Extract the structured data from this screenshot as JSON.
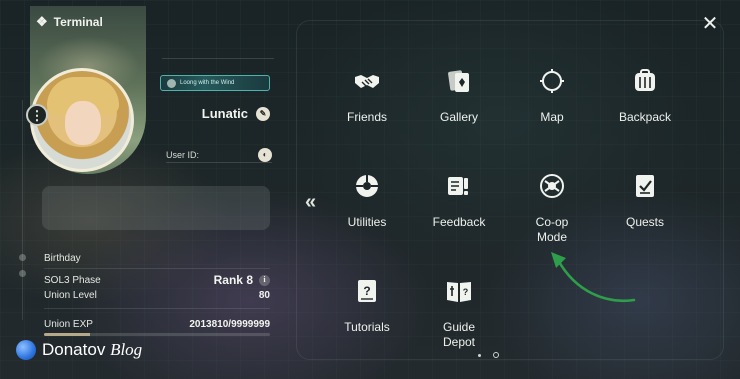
{
  "header": {
    "title": "Terminal"
  },
  "profile": {
    "title_badge": "Loong with the Wind",
    "username": "Lunatic",
    "user_id_label": "User ID:",
    "user_id_value": ""
  },
  "stats": {
    "birthday_label": "Birthday",
    "sol3_label": "SOL3 Phase",
    "sol3_value": "Rank 8",
    "union_level_label": "Union Level",
    "union_level_value": "80",
    "union_exp_label": "Union EXP",
    "union_exp_value": "2013810/9999999",
    "union_exp_fraction": 0.2014
  },
  "menu": {
    "items": [
      {
        "label": "Friends",
        "icon": "handshake-icon"
      },
      {
        "label": "Gallery",
        "icon": "cards-icon"
      },
      {
        "label": "Map",
        "icon": "compass-icon"
      },
      {
        "label": "Backpack",
        "icon": "backpack-icon"
      },
      {
        "label": "Utilities",
        "icon": "utilities-icon"
      },
      {
        "label": "Feedback",
        "icon": "feedback-icon"
      },
      {
        "label": "Co-op Mode",
        "label_line1": "Co-op",
        "label_line2": "Mode",
        "icon": "coop-icon"
      },
      {
        "label": "Quests",
        "icon": "quests-icon"
      },
      {
        "label": "Tutorials",
        "icon": "tutorial-book-icon"
      },
      {
        "label": "Guide Depot",
        "label_line1": "Guide",
        "label_line2": "Depot",
        "icon": "guide-book-icon"
      }
    ]
  },
  "watermark": {
    "brand": "Donatov",
    "suffix": "Blog"
  },
  "colors": {
    "annotation_arrow": "#2e9e4a",
    "badge_border": "#4fb3ad",
    "exp_fill": "#b6a98a"
  }
}
